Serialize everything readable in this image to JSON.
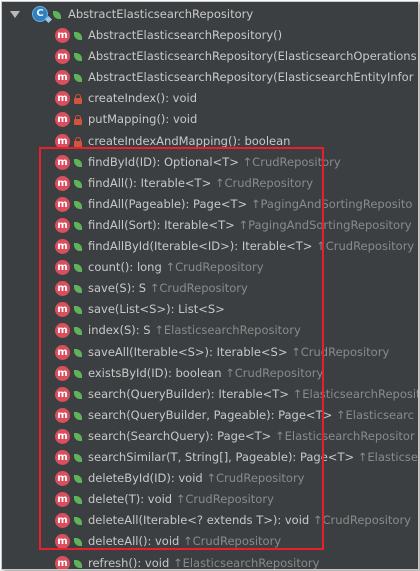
{
  "colors": {
    "background": "#3c3f41",
    "text": "#c8c8c8",
    "origin_text": "#8a8a8a",
    "method_icon": "#d94f5e",
    "public_icon": "#5fb45a",
    "private_icon": "#d3533d",
    "highlight_border": "#e81f2c"
  },
  "tree": {
    "root": {
      "icon": "class-icon",
      "icon_letter": "C",
      "label": "AbstractElasticsearchRepository"
    },
    "members": [
      {
        "vis": "public",
        "sig": "AbstractElasticsearchRepository()",
        "origin": ""
      },
      {
        "vis": "public",
        "sig": "AbstractElasticsearchRepository(ElasticsearchOperations",
        "origin": ""
      },
      {
        "vis": "public",
        "sig": "AbstractElasticsearchRepository(ElasticsearchEntityInfor",
        "origin": ""
      },
      {
        "vis": "private",
        "sig": "createIndex(): void",
        "origin": ""
      },
      {
        "vis": "private",
        "sig": "putMapping(): void",
        "origin": ""
      },
      {
        "vis": "private",
        "sig": "createIndexAndMapping(): boolean",
        "origin": ""
      },
      {
        "vis": "public",
        "sig": "findById(ID): Optional<T>",
        "origin": "↑CrudRepository"
      },
      {
        "vis": "public",
        "sig": "findAll(): Iterable<T>",
        "origin": "↑CrudRepository"
      },
      {
        "vis": "public",
        "sig": "findAll(Pageable): Page<T>",
        "origin": "↑PagingAndSortingReposito"
      },
      {
        "vis": "public",
        "sig": "findAll(Sort): Iterable<T>",
        "origin": "↑PagingAndSortingRepository"
      },
      {
        "vis": "public",
        "sig": "findAllById(Iterable<ID>): Iterable<T>",
        "origin": "↑CrudRepository"
      },
      {
        "vis": "public",
        "sig": "count(): long",
        "origin": "↑CrudRepository"
      },
      {
        "vis": "public",
        "sig": "save(S): S",
        "origin": "↑CrudRepository"
      },
      {
        "vis": "public",
        "sig": "save(List<S>): List<S>",
        "origin": ""
      },
      {
        "vis": "public",
        "sig": "index(S): S",
        "origin": "↑ElasticsearchRepository"
      },
      {
        "vis": "public",
        "sig": "saveAll(Iterable<S>): Iterable<S>",
        "origin": "↑CrudRepository"
      },
      {
        "vis": "public",
        "sig": "existsById(ID): boolean",
        "origin": "↑CrudRepository"
      },
      {
        "vis": "public",
        "sig": "search(QueryBuilder): Iterable<T>",
        "origin": "↑ElasticsearchReposit"
      },
      {
        "vis": "public",
        "sig": "search(QueryBuilder, Pageable): Page<T>",
        "origin": "↑Elasticsearc"
      },
      {
        "vis": "public",
        "sig": "search(SearchQuery): Page<T>",
        "origin": "↑ElasticsearchRepositor"
      },
      {
        "vis": "public",
        "sig": "searchSimilar(T, String[], Pageable): Page<T>",
        "origin": "↑Elasticse"
      },
      {
        "vis": "public",
        "sig": "deleteById(ID): void",
        "origin": "↑CrudRepository"
      },
      {
        "vis": "public",
        "sig": "delete(T): void",
        "origin": "↑CrudRepository"
      },
      {
        "vis": "public",
        "sig": "deleteAll(Iterable<? extends T>): void",
        "origin": "↑CrudRepository"
      },
      {
        "vis": "public",
        "sig": "deleteAll(): void",
        "origin": "↑CrudRepository"
      },
      {
        "vis": "public",
        "sig": "refresh(): void",
        "origin": "↑ElasticsearchRepository"
      }
    ]
  }
}
